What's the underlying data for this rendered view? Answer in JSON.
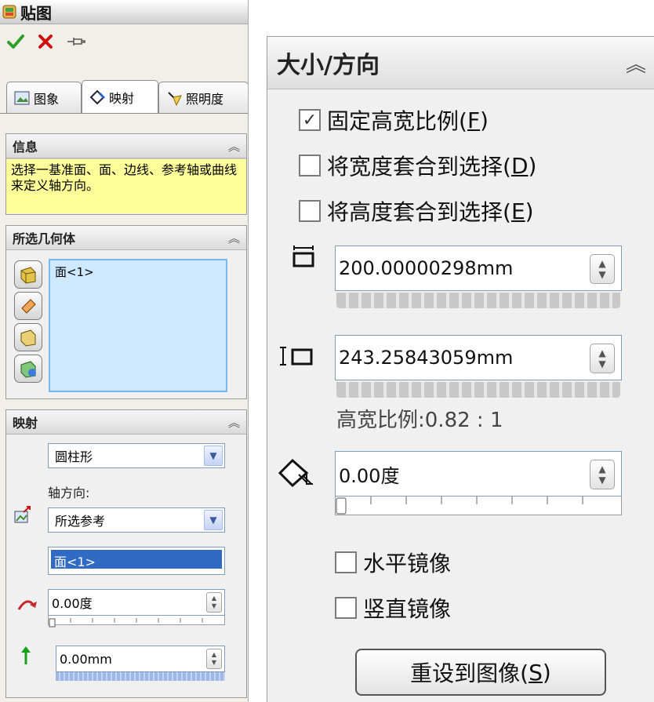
{
  "left_panel": {
    "title": "贴图",
    "tabs": [
      "图象",
      "映射",
      "照明度"
    ],
    "info_section": {
      "title": "信息",
      "message": "选择一基准面、面、边线、参考轴或曲线来定义轴方向。"
    },
    "geometry_section": {
      "title": "所选几何体",
      "items": [
        "面<1>"
      ]
    },
    "mapping_section": {
      "title": "映射",
      "mapping_type": "圆柱形",
      "axis_label": "轴方向:",
      "axis_value": "所选参考",
      "reference": "面<1>",
      "rotation": "0.00度",
      "offset": "0.00mm"
    }
  },
  "right_panel": {
    "title": "大小/方向",
    "lock_aspect": {
      "label": "固定高宽比例(",
      "key": "F",
      "suffix": ")",
      "checked": true
    },
    "fit_width": {
      "label": "将宽度套合到选择(",
      "key": "D",
      "suffix": ")",
      "checked": false
    },
    "fit_height": {
      "label": "将高度套合到选择(",
      "key": "E",
      "suffix": ")",
      "checked": false
    },
    "width": "200.00000298mm",
    "height": "243.25843059mm",
    "aspect_ratio": "高宽比例:0.82 : 1",
    "angle": "0.00度",
    "mirror_horizontal": {
      "label": "水平镜像",
      "checked": false
    },
    "mirror_vertical": {
      "label": "竖直镜像",
      "checked": false
    },
    "reset_button": {
      "label": "重设到图像(",
      "key": "S",
      "suffix": ")"
    }
  },
  "colors": {
    "info_bg": "#ffff99",
    "selection_bg": "#cde8ff",
    "highlight": "#316ac5",
    "ok": "#2e9e2e",
    "cancel": "#d01010"
  }
}
